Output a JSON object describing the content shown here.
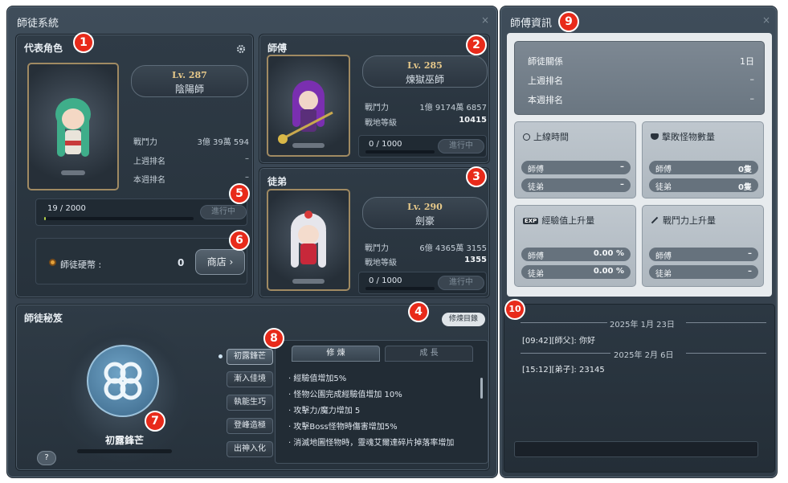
{
  "main_window": {
    "title": "師徒系統",
    "close": "×"
  },
  "rep_char": {
    "title": "代表角色",
    "level": "Lv. 287",
    "job": "陰陽師",
    "stats": [
      {
        "label": "戰鬥力",
        "value": "3億 39萬 594"
      },
      {
        "label": "上週排名",
        "value": "–"
      },
      {
        "label": "本週排名",
        "value": "–"
      }
    ],
    "progress_text": "19 / 2000",
    "progress_fraction": 0.0095,
    "progress_button": "進行中",
    "coin_label": "師徒硬幣 :",
    "coin_value": "0",
    "shop_button": "商店 ›"
  },
  "master": {
    "title": "師傅",
    "level": "Lv. 285",
    "job": "煉獄巫師",
    "stats": [
      {
        "label": "戰鬥力",
        "value": "1億 9174萬 6857"
      },
      {
        "label": "戰地等級",
        "value": "10415"
      }
    ],
    "progress_text": "0 / 1000",
    "progress_button": "進行中"
  },
  "disciple": {
    "title": "徒弟",
    "level": "Lv. 290",
    "job": "劍豪",
    "stats": [
      {
        "label": "戰鬥力",
        "value": "6億 4365萬 3155"
      },
      {
        "label": "戰地等級",
        "value": "1355"
      }
    ],
    "progress_text": "0 / 1000",
    "progress_button": "進行中"
  },
  "secret": {
    "title": "師徒秘笈",
    "training_list_button": "修煉目錄",
    "emblem_name": "初露鋒芒",
    "help": "?",
    "stages": [
      "初露鋒芒",
      "漸入佳境",
      "執能生巧",
      "登峰造極",
      "出神入化"
    ],
    "tabs": [
      "修 煉",
      "成 長"
    ],
    "effects": [
      "· 經驗值增加5%",
      "· 怪物公園完成經驗值增加 10%",
      "· 攻擊力/魔力增加 5",
      "· 攻擊Boss怪物時傷害增加5%",
      "· 消滅地圖怪物時，靈魂艾爾達碎片掉落率增加"
    ]
  },
  "info_window": {
    "title": "師傅資訊",
    "close": "×",
    "summary": [
      {
        "label": "師徒關係",
        "value": "1日"
      },
      {
        "label": "上週排名",
        "value": "–"
      },
      {
        "label": "本週排名",
        "value": "–"
      }
    ],
    "cards": [
      {
        "title": "上線時間",
        "icon": "clock-icon",
        "rows": [
          {
            "label": "師傅",
            "value": "–"
          },
          {
            "label": "徒弟",
            "value": "–"
          }
        ]
      },
      {
        "title": "擊敗怪物數量",
        "icon": "monster-icon",
        "rows": [
          {
            "label": "師傅",
            "value": "0隻"
          },
          {
            "label": "徒弟",
            "value": "0隻"
          }
        ]
      },
      {
        "title": "經驗值上升量",
        "icon": "exp-icon",
        "rows": [
          {
            "label": "師傅",
            "value": "0.00 %"
          },
          {
            "label": "徒弟",
            "value": "0.00 %"
          }
        ]
      },
      {
        "title": "戰鬥力上升量",
        "icon": "sword-icon",
        "rows": [
          {
            "label": "師傅",
            "value": "–"
          },
          {
            "label": "徒弟",
            "value": "–"
          }
        ]
      }
    ]
  },
  "chat": {
    "date1": "2025年 1月 23日",
    "line1": "[09:42][師父]: 你好",
    "date2": "2025年 2月 6日",
    "line2": "[15:12][弟子]: 23145",
    "input_placeholder": ""
  },
  "badges": [
    "1",
    "2",
    "3",
    "4",
    "5",
    "6",
    "7",
    "8",
    "9",
    "10"
  ],
  "colors": {
    "badge": "#e82a1a",
    "level": "#e7c98a",
    "panel": "#2f3b46",
    "info_card": "#bfc7ce"
  }
}
